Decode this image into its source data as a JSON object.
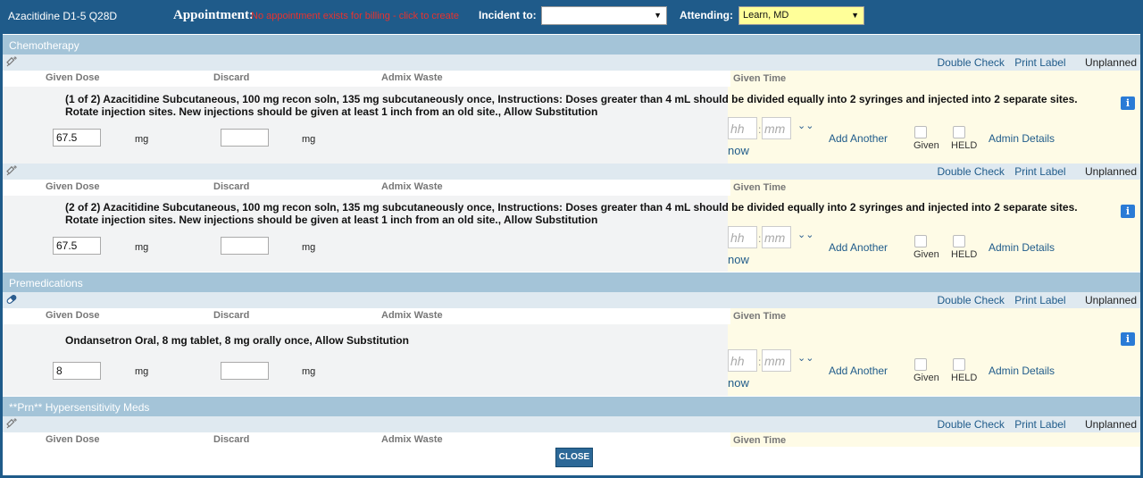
{
  "header": {
    "title": "Azacitidine D1-5 Q28D",
    "appointment_label": "Appointment:",
    "appointment_message": "No appointment exists for billing - click to create",
    "incident_label": "Incident to:",
    "incident_value": "",
    "attending_label": "Attending:",
    "attending_value": "Learn, MD"
  },
  "labels": {
    "given_dose": "Given Dose",
    "discard": "Discard",
    "admix_waste": "Admix Waste",
    "given_time": "Given Time",
    "double_check": "Double Check",
    "print_label": "Print Label",
    "unplanned": "Unplanned",
    "mg": "mg",
    "hh": "hh",
    "mm": "mm",
    "colon": ":",
    "now": "now",
    "add_another": "Add Another",
    "given": "Given",
    "held": "HELD",
    "admin_details": "Admin Details",
    "info": "i",
    "chevron": "⌄⌄"
  },
  "sections": {
    "chemotherapy": "Chemotherapy",
    "premedications": "Premedications",
    "prn": "**Prn** Hypersensitivity Meds"
  },
  "orders": [
    {
      "instructions": "(1 of 2) Azacitidine Subcutaneous, 100 mg recon soln, 135 mg subcutaneously once, Instructions: Doses greater than 4 mL should be divided equally into 2 syringes and injected into 2 separate sites. Rotate injection sites. New injections should be given at least 1 inch from an old site., Allow Substitution",
      "dose": "67.5",
      "discard": ""
    },
    {
      "instructions": "(2 of 2) Azacitidine Subcutaneous, 100 mg recon soln, 135 mg subcutaneously once, Instructions: Doses greater than 4 mL should be divided equally into 2 syringes and injected into 2 separate sites. Rotate injection sites. New injections should be given at least 1 inch from an old site., Allow Substitution",
      "dose": "67.5",
      "discard": ""
    },
    {
      "instructions": "Ondansetron Oral, 8 mg tablet, 8 mg orally once, Allow Substitution",
      "dose": "8",
      "discard": ""
    }
  ],
  "close_button": "CLOSE",
  "colors": {
    "header_bg": "#1f5b8a",
    "section_bar": "#a4c4d8",
    "link": "#1f5b8a",
    "alert": "#e8322e",
    "attending_bg": "#ffff99",
    "given_time_bg": "#fefbe6"
  },
  "icons": {
    "tool_syringe": "syringe-icon",
    "tool_pill": "pill-icon",
    "info": "info-icon",
    "chevron": "double-chevron-down-icon"
  }
}
